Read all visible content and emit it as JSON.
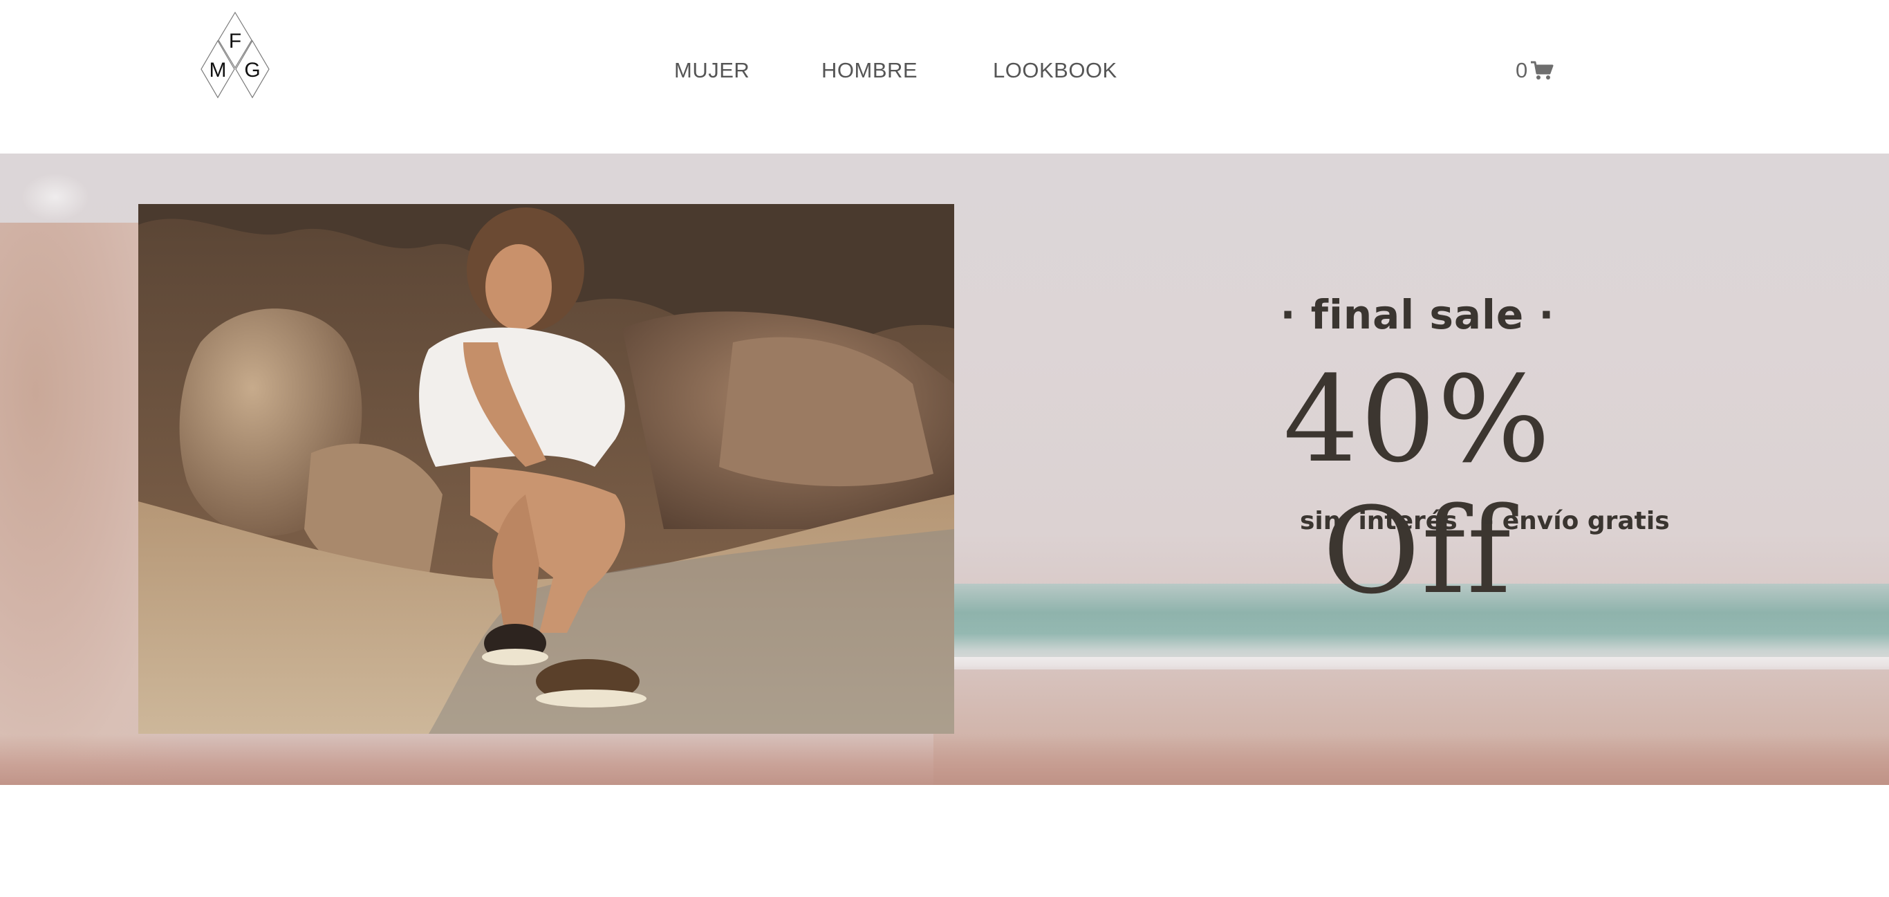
{
  "header": {
    "logo": {
      "letters": [
        "F",
        "M",
        "G"
      ],
      "icon": "diamond-monogram-logo"
    },
    "nav": [
      {
        "label": "MUJER"
      },
      {
        "label": "HOMBRE"
      },
      {
        "label": "LOOKBOOK"
      }
    ],
    "cart": {
      "count": "0",
      "icon": "shopping-cart-icon"
    }
  },
  "hero": {
    "kicker": "· final sale ·",
    "headline": "40% Off",
    "subline": "sin  interés   - envío gratis",
    "colors": {
      "text": "#3a3530",
      "sea": "#8fb3ac",
      "sand": "#d1b4aa"
    }
  }
}
